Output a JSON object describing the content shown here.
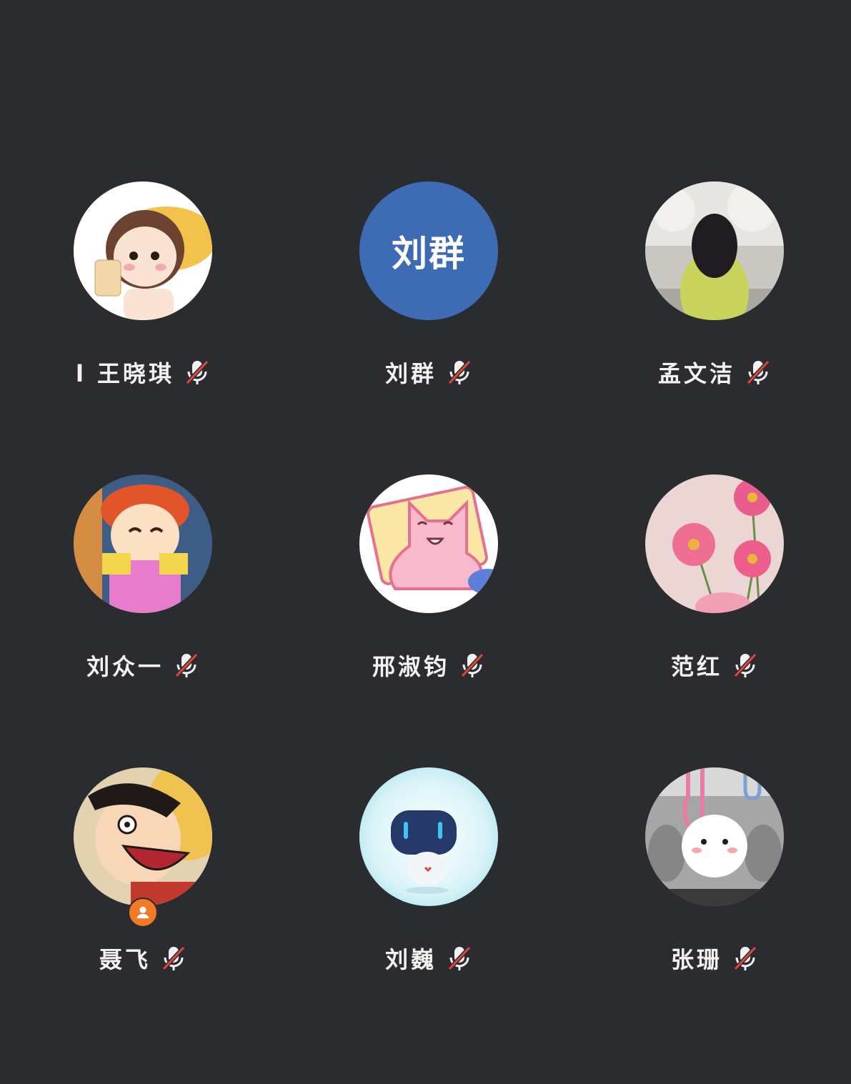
{
  "participants": [
    {
      "name": "l 王晓琪",
      "avatar": "girl-with-milk-tea-cartoon",
      "mic": "mic-muted-icon"
    },
    {
      "name": "刘群",
      "avatar_text": "刘群",
      "avatar_color": "#3d6cb5",
      "mic": "mic-muted-icon"
    },
    {
      "name": "孟文洁",
      "avatar": "girl-in-yellow-sweater-photo",
      "mic": "mic-muted-icon"
    },
    {
      "name": "刘众一",
      "avatar": "red-haired-girl-cartoon",
      "mic": "mic-muted-icon"
    },
    {
      "name": "邢淑钧",
      "avatar": "pink-cat-cartoon",
      "mic": "mic-muted-icon"
    },
    {
      "name": "范红",
      "avatar": "pink-flowers-photo",
      "mic": "mic-muted-icon"
    },
    {
      "name": "聂飞",
      "avatar": "laughing-pirate-cartoon",
      "mic": "mic-muted-icon",
      "badge": "host-badge"
    },
    {
      "name": "刘巍",
      "avatar": "white-robot-mascot",
      "mic": "mic-muted-icon"
    },
    {
      "name": "张珊",
      "avatar": "white-bear-on-subway-cartoon",
      "mic": "mic-muted-icon"
    }
  ],
  "colors": {
    "background": "#2a2c30",
    "mute_slash": "#e0443a",
    "host_badge": "#f07a26"
  }
}
